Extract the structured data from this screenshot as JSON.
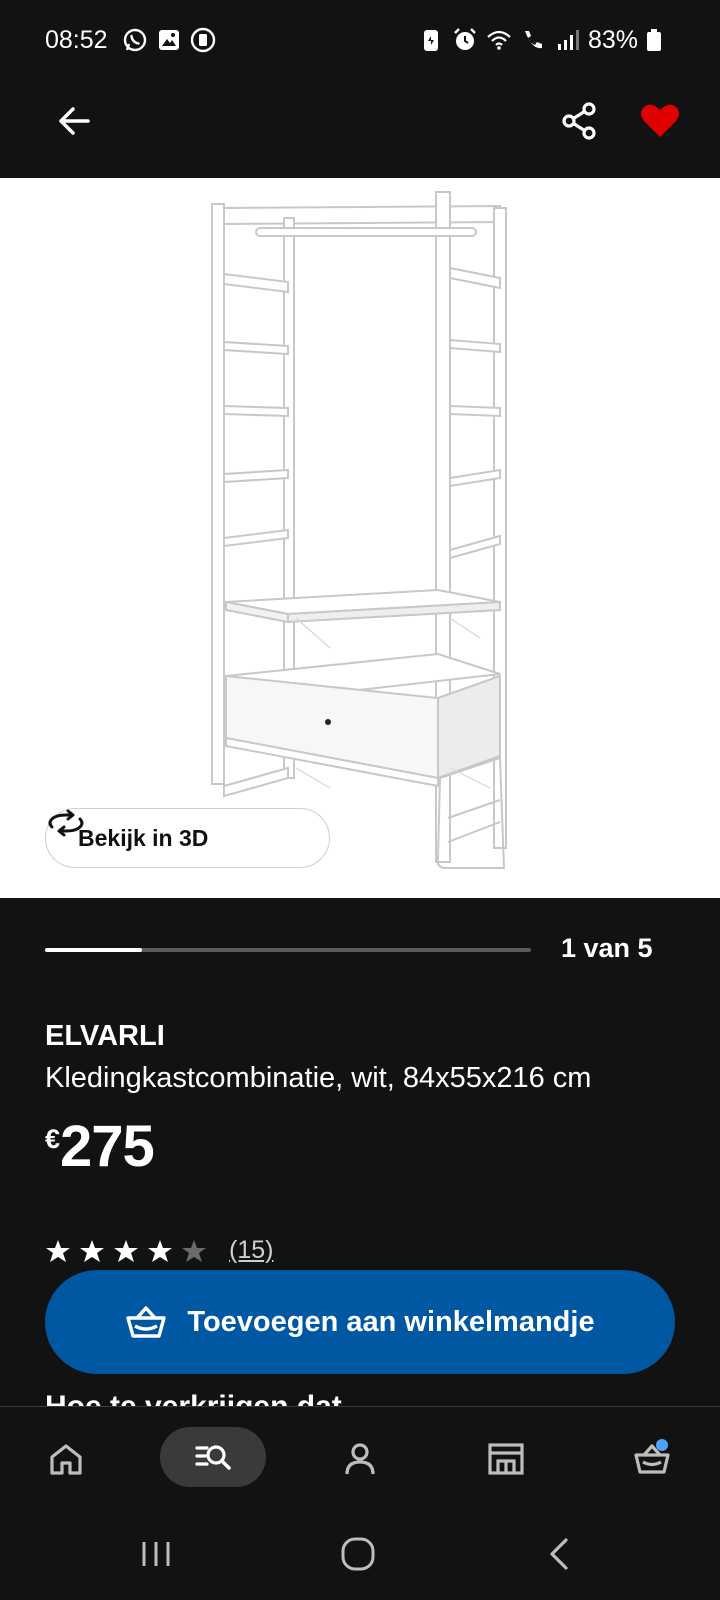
{
  "status_bar": {
    "time": "08:52",
    "battery": "83%",
    "left_icons": [
      "whatsapp-icon",
      "gallery-icon",
      "recorder-icon"
    ],
    "right_icons": [
      "battery-saver-icon",
      "alarm-icon",
      "wifi-icon",
      "wifi-call-icon",
      "signal-icon",
      "battery-icon"
    ]
  },
  "app_bar": {
    "icons": [
      "arrow-left-icon",
      "share-icon",
      "heart-icon"
    ],
    "favorite_color": "#e00000"
  },
  "hero": {
    "view_3d_label": "Bekijk in 3D",
    "view_3d_icon": "rotate-3d-icon"
  },
  "gallery": {
    "counter": "1 van 5",
    "current": 1,
    "total": 5
  },
  "product": {
    "name": "ELVARLI",
    "description": "Kledingkastcombinatie, wit, 84x55x216 cm",
    "price_currency": "€",
    "price_amount": "275",
    "rating": 4,
    "rating_max": 5,
    "rating_count": "(15)"
  },
  "cart_button": {
    "label": "Toevoegen aan winkelmandje",
    "icon": "basket-icon",
    "color": "#0058a3"
  },
  "next_section": {
    "heading_partial": "Hoe te verkrijgen dat"
  },
  "bottom_nav": {
    "items": [
      "home-icon",
      "search-icon",
      "profile-icon",
      "store-icon",
      "cart-icon"
    ],
    "active": "search-icon"
  },
  "system_nav": {
    "items": [
      "recents-icon",
      "home-circle-icon",
      "back-chevron-icon"
    ]
  }
}
